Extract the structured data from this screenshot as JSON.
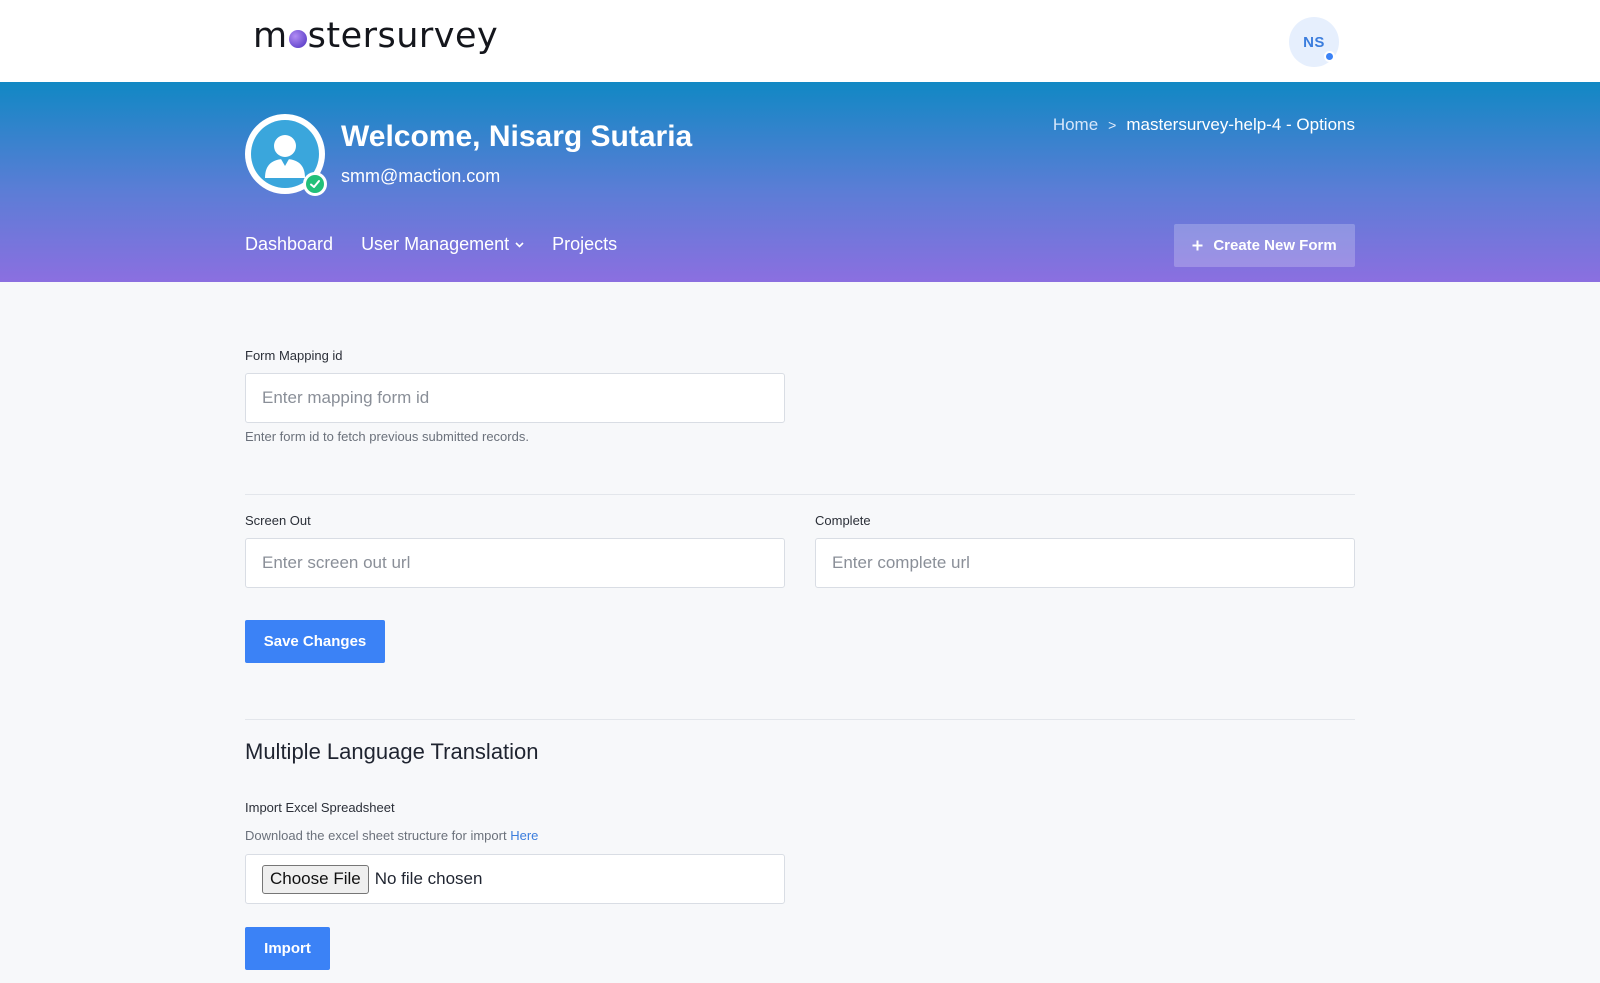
{
  "topbar": {
    "logo_prefix": "m",
    "logo_suffix": "stersurvey",
    "avatar_initials": "NS"
  },
  "hero": {
    "welcome": "Welcome, Nisarg Sutaria",
    "email": "smm@maction.com",
    "breadcrumb": {
      "home": "Home",
      "separator": ">",
      "current": "mastersurvey-help-4 - Options"
    },
    "nav": {
      "dashboard": "Dashboard",
      "user_management": "User Management",
      "projects": "Projects"
    },
    "create_button": "Create New Form"
  },
  "form": {
    "mapping": {
      "label": "Form Mapping id",
      "placeholder": "Enter mapping form id",
      "value": "",
      "help": "Enter form id to fetch previous submitted records."
    },
    "screen_out": {
      "label": "Screen Out",
      "placeholder": "Enter screen out url",
      "value": ""
    },
    "complete": {
      "label": "Complete",
      "placeholder": "Enter complete url",
      "value": ""
    },
    "save_button": "Save Changes"
  },
  "translation": {
    "title": "Multiple Language Translation",
    "import_label": "Import Excel Spreadsheet",
    "help_text": "Download the excel sheet structure for import",
    "help_link": "Here",
    "file_button": "Choose File",
    "file_status": "No file chosen",
    "import_button": "Import"
  },
  "icons": {
    "logo_dot": "gradient-dot-icon",
    "profile": "user-silhouette-icon",
    "verified": "check-circle-icon",
    "dropdown": "chevron-down-icon",
    "plus": "plus-icon"
  },
  "colors": {
    "primary": "#3b82f6",
    "gradient_top": "#1188c4",
    "gradient_bottom": "#8b6fe0",
    "verified": "#22c07a"
  }
}
